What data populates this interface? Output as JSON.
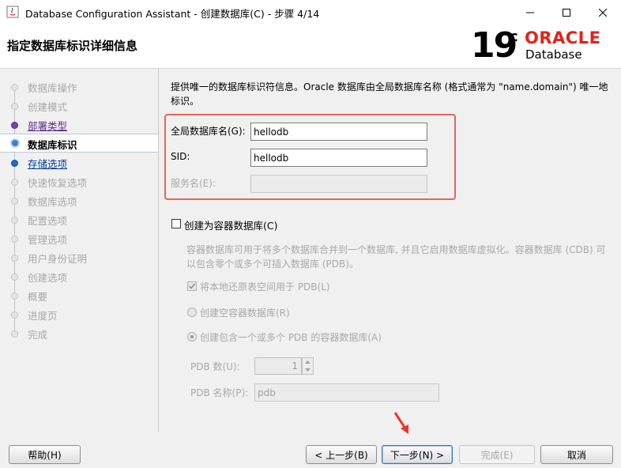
{
  "window": {
    "title": "Database Configuration Assistant - 创建数据库(C) - 步骤 4/14"
  },
  "header": {
    "heading": "指定数据库标识详细信息",
    "logo_version": "19",
    "logo_superscript": "c",
    "logo_brand": "ORACLE",
    "logo_product": "Database",
    "brand_color": "#e2231a"
  },
  "nav": {
    "items": [
      {
        "label": "数据库操作",
        "state": "disabled"
      },
      {
        "label": "创建模式",
        "state": "disabled"
      },
      {
        "label": "部署类型",
        "state": "done"
      },
      {
        "label": "数据库标识",
        "state": "active"
      },
      {
        "label": "存储选项",
        "state": "link"
      },
      {
        "label": "快速恢复选项",
        "state": "disabled"
      },
      {
        "label": "数据库选项",
        "state": "disabled"
      },
      {
        "label": "配置选项",
        "state": "disabled"
      },
      {
        "label": "管理选项",
        "state": "disabled"
      },
      {
        "label": "用户身份证明",
        "state": "disabled"
      },
      {
        "label": "创建选项",
        "state": "disabled"
      },
      {
        "label": "概要",
        "state": "disabled"
      },
      {
        "label": "进度页",
        "state": "disabled"
      },
      {
        "label": "完成",
        "state": "disabled"
      }
    ]
  },
  "main": {
    "description": "提供唯一的数据库标识符信息。Oracle 数据库由全局数据库名称 (格式通常为 \"name.domain\") 唯一地标识。",
    "global_db_name": {
      "label": "全局数据库名(G):",
      "value": "hellodb"
    },
    "sid": {
      "label": "SID:",
      "value": "hellodb"
    },
    "service_name": {
      "label": "服务名(E):",
      "value": ""
    },
    "container_db": {
      "label": "创建为容器数据库(C)",
      "checked": false,
      "description": "容器数据库可用于将多个数据库合并到一个数据库, 并且它启用数据库虚拟化。容器数据库 (CDB) 可以包含零个或多个可插入数据库 (PDB)。",
      "local_undo": {
        "label": "将本地还原表空间用于 PDB(L)",
        "checked": true
      },
      "empty_cdb": {
        "label": "创建空容器数据库(R)",
        "selected": false
      },
      "with_pdb": {
        "label": "创建包含一个或多个 PDB 的容器数据库(A)",
        "selected": true
      },
      "pdb_count": {
        "label": "PDB 数(U):",
        "value": "1"
      },
      "pdb_name": {
        "label": "PDB 名称(P):",
        "value": "pdb"
      }
    }
  },
  "buttons": {
    "help": "帮助(H)",
    "back": "< 上一步(B)",
    "next": "下一步(N) >",
    "finish": "完成(E)",
    "cancel": "取消"
  }
}
